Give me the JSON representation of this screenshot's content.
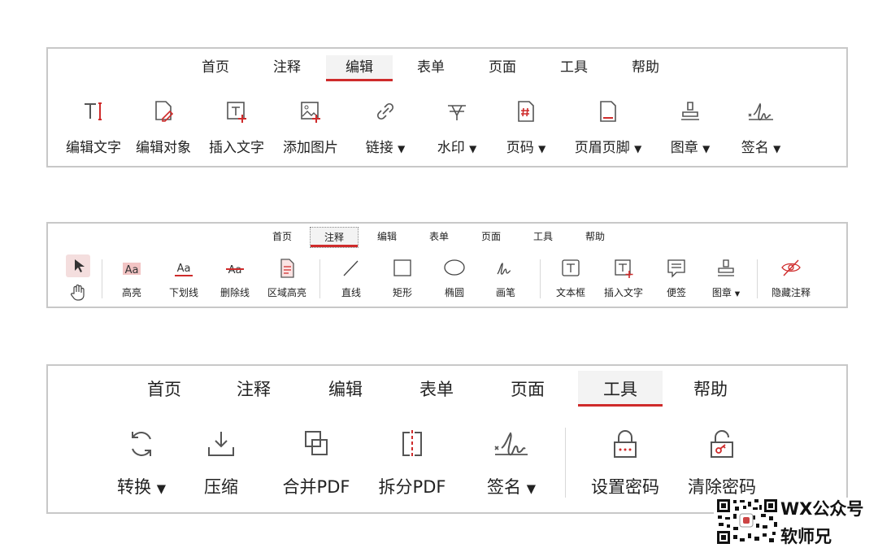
{
  "toolbar_edit": {
    "tabs": [
      "首页",
      "注释",
      "编辑",
      "表单",
      "页面",
      "工具",
      "帮助"
    ],
    "active_tab": "编辑",
    "tools": {
      "edit_text": "编辑文字",
      "edit_object": "编辑对象",
      "insert_text": "插入文字",
      "add_image": "添加图片",
      "link": "链接",
      "watermark": "水印",
      "page_number": "页码",
      "header_footer": "页眉页脚",
      "stamp": "图章",
      "signature": "签名"
    },
    "dropdown_arrow": "▼"
  },
  "toolbar_annotate": {
    "tabs": [
      "首页",
      "注释",
      "编辑",
      "表单",
      "页面",
      "工具",
      "帮助"
    ],
    "active_tab": "注释",
    "tools": {
      "highlight": "高亮",
      "underline": "下划线",
      "strikethrough": "删除线",
      "area_highlight": "区域高亮",
      "line": "直线",
      "rectangle": "矩形",
      "ellipse": "椭圆",
      "pen": "画笔",
      "textbox": "文本框",
      "insert_text": "插入文字",
      "sticky_note": "便签",
      "stamp": "图章",
      "hide_annotations": "隐藏注释"
    },
    "icon_glyphs": {
      "aa": "Aa"
    }
  },
  "toolbar_tools": {
    "tabs": [
      "首页",
      "注释",
      "编辑",
      "表单",
      "页面",
      "工具",
      "帮助"
    ],
    "active_tab": "工具",
    "tools": {
      "convert": "转换",
      "compress": "压缩",
      "merge_pdf": "合并PDF",
      "split_pdf": "拆分PDF",
      "signature": "签名",
      "set_password": "设置密码",
      "clear_password": "清除密码"
    }
  },
  "watermark": {
    "line1": "WX公众号",
    "line2": "软师兄"
  },
  "colors": {
    "accent": "#cf2b2b",
    "icon": "#555555",
    "border": "#c8c8c8",
    "active_tab_bg": "#f3f3f3"
  }
}
